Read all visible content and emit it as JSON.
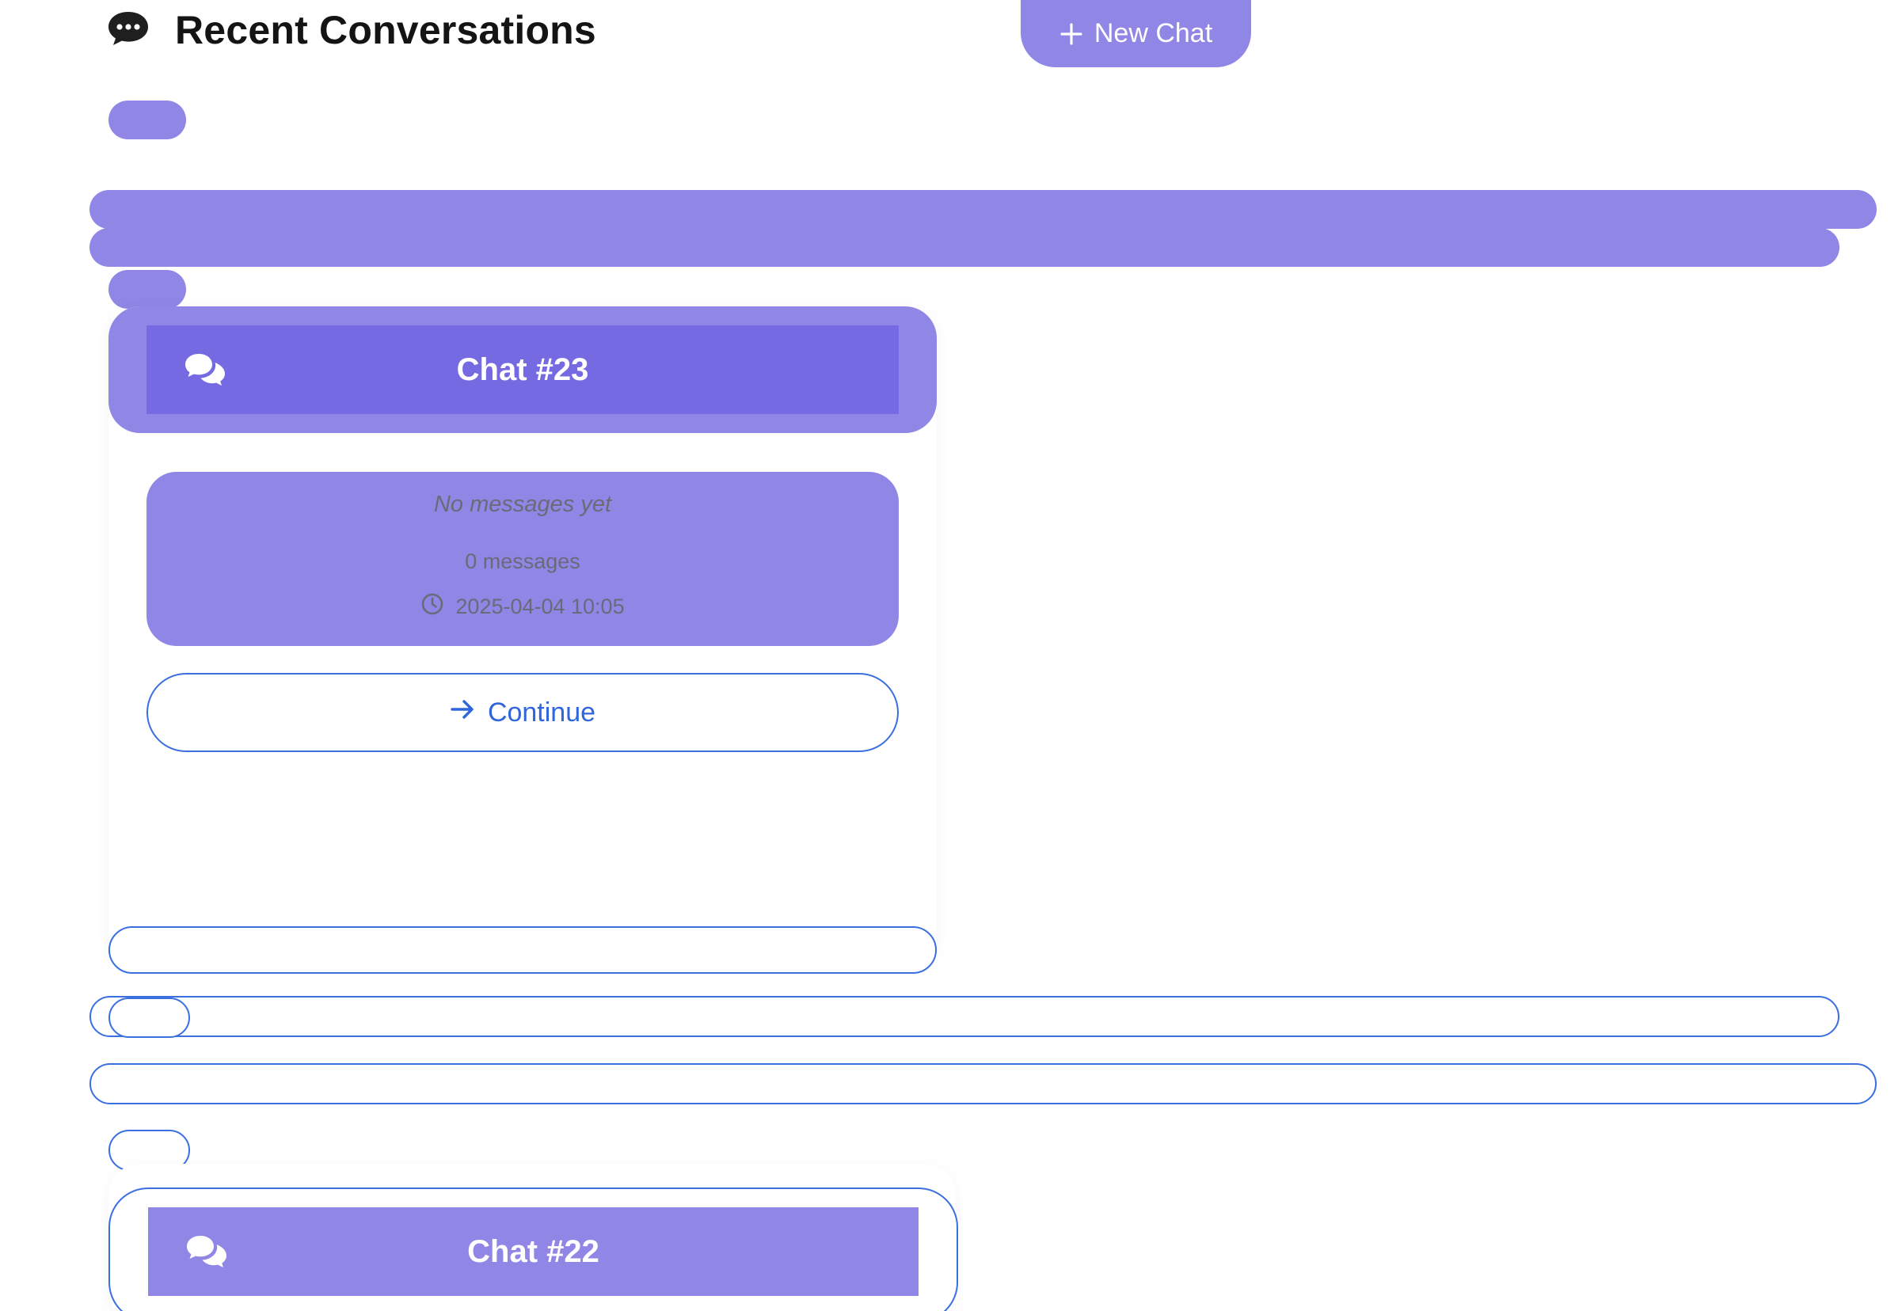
{
  "header": {
    "title": "Recent Conversations",
    "icon": "chat-bubble-ellipsis-icon",
    "new_chat_label": "New Chat",
    "new_chat_icon": "plus-icon"
  },
  "colors": {
    "accent": "#8f86e6",
    "accent_dark": "#756ae2",
    "outline_blue": "#3b6fe0",
    "link_blue": "#2f66dd",
    "muted_text": "#6a6a78"
  },
  "conversations": [
    {
      "title": "Chat #23",
      "icon": "chat-bubbles-icon",
      "preview": "No messages yet",
      "message_count": "0 messages",
      "timestamp": "2025-04-04 10:05",
      "timestamp_icon": "clock-icon",
      "continue_label": "Continue",
      "continue_icon": "arrow-right-icon"
    },
    {
      "title": "Chat #22",
      "icon": "chat-bubbles-icon"
    }
  ]
}
